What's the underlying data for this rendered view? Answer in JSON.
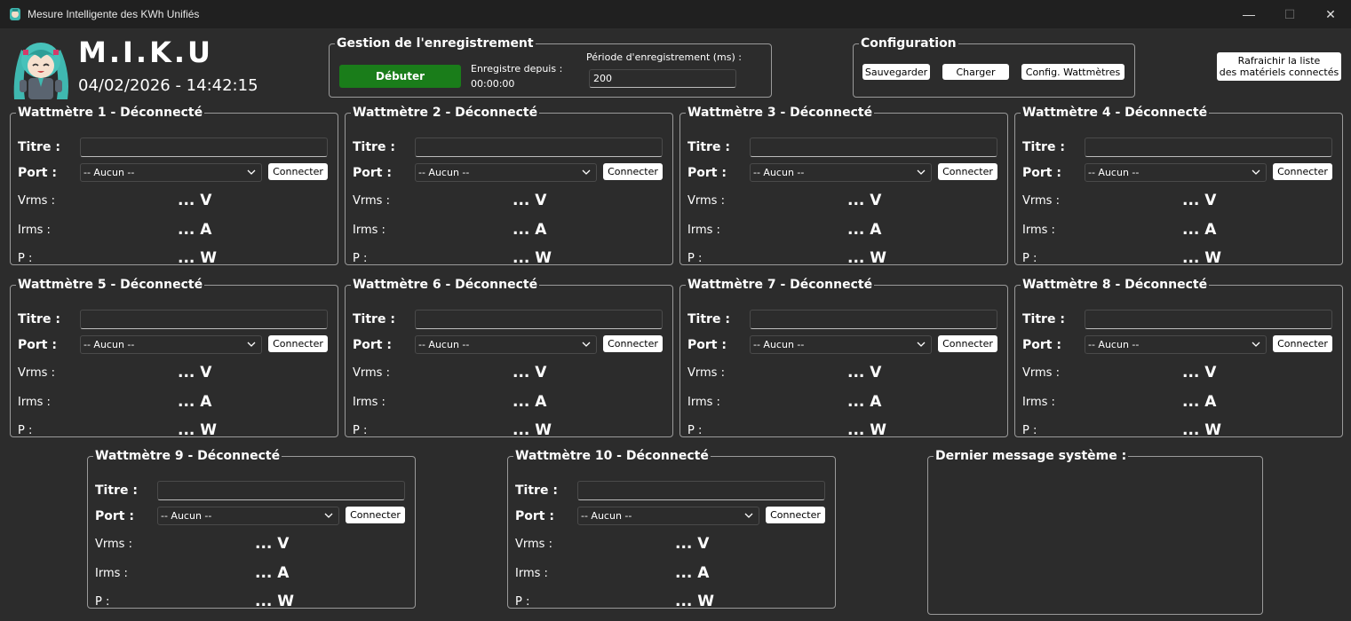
{
  "window": {
    "title": "Mesure Intelligente des KWh Unifiés",
    "minimize_glyph": "—",
    "maximize_glyph": "☐",
    "close_glyph": "✕"
  },
  "header": {
    "app_name": "M.I.K.U",
    "datetime": "04/02/2026 - 14:42:15"
  },
  "recording": {
    "legend": "Gestion de l'enregistrement",
    "start_label": "Débuter",
    "since_label": "Enregistre depuis :",
    "since_value": "00:00:00",
    "period_label": "Période d'enregistrement (ms) :",
    "period_value": "200"
  },
  "configuration": {
    "legend": "Configuration",
    "save_label": "Sauvegarder",
    "load_label": "Charger",
    "config_label": "Config. Wattmètres"
  },
  "refresh_label": "Rafraichir la liste\ndes matériels connectés",
  "wattmeter_labels": {
    "title": "Titre :",
    "port": "Port :",
    "vrms": "Vrms :",
    "irms": "Irms :",
    "p": "P :",
    "port_none": "-- Aucun --",
    "connect": "Connecter"
  },
  "wattmeters": [
    {
      "legend": "Wattmètre 1 - Déconnecté",
      "title": "",
      "port": "-- Aucun --",
      "vrms": "... V",
      "irms": "... A",
      "p": "... W"
    },
    {
      "legend": "Wattmètre 2 - Déconnecté",
      "title": "",
      "port": "-- Aucun --",
      "vrms": "... V",
      "irms": "... A",
      "p": "... W"
    },
    {
      "legend": "Wattmètre 3 - Déconnecté",
      "title": "",
      "port": "-- Aucun --",
      "vrms": "... V",
      "irms": "... A",
      "p": "... W"
    },
    {
      "legend": "Wattmètre 4 - Déconnecté",
      "title": "",
      "port": "-- Aucun --",
      "vrms": "... V",
      "irms": "... A",
      "p": "... W"
    },
    {
      "legend": "Wattmètre 5 - Déconnecté",
      "title": "",
      "port": "-- Aucun --",
      "vrms": "... V",
      "irms": "... A",
      "p": "... W"
    },
    {
      "legend": "Wattmètre 6 - Déconnecté",
      "title": "",
      "port": "-- Aucun --",
      "vrms": "... V",
      "irms": "... A",
      "p": "... W"
    },
    {
      "legend": "Wattmètre 7 - Déconnecté",
      "title": "",
      "port": "-- Aucun --",
      "vrms": "... V",
      "irms": "... A",
      "p": "... W"
    },
    {
      "legend": "Wattmètre 8 - Déconnecté",
      "title": "",
      "port": "-- Aucun --",
      "vrms": "... V",
      "irms": "... A",
      "p": "... W"
    },
    {
      "legend": "Wattmètre 9 - Déconnecté",
      "title": "",
      "port": "-- Aucun --",
      "vrms": "... V",
      "irms": "... A",
      "p": "... W"
    },
    {
      "legend": "Wattmètre 10 - Déconnecté",
      "title": "",
      "port": "-- Aucun --",
      "vrms": "... V",
      "irms": "... A",
      "p": "... W"
    }
  ],
  "system_message": {
    "legend": "Dernier message système :",
    "text": ""
  },
  "colors": {
    "background": "#2c2c2c",
    "titlebar": "#202020",
    "start_button": "#1a7d1a",
    "border": "#9a9a9a"
  }
}
